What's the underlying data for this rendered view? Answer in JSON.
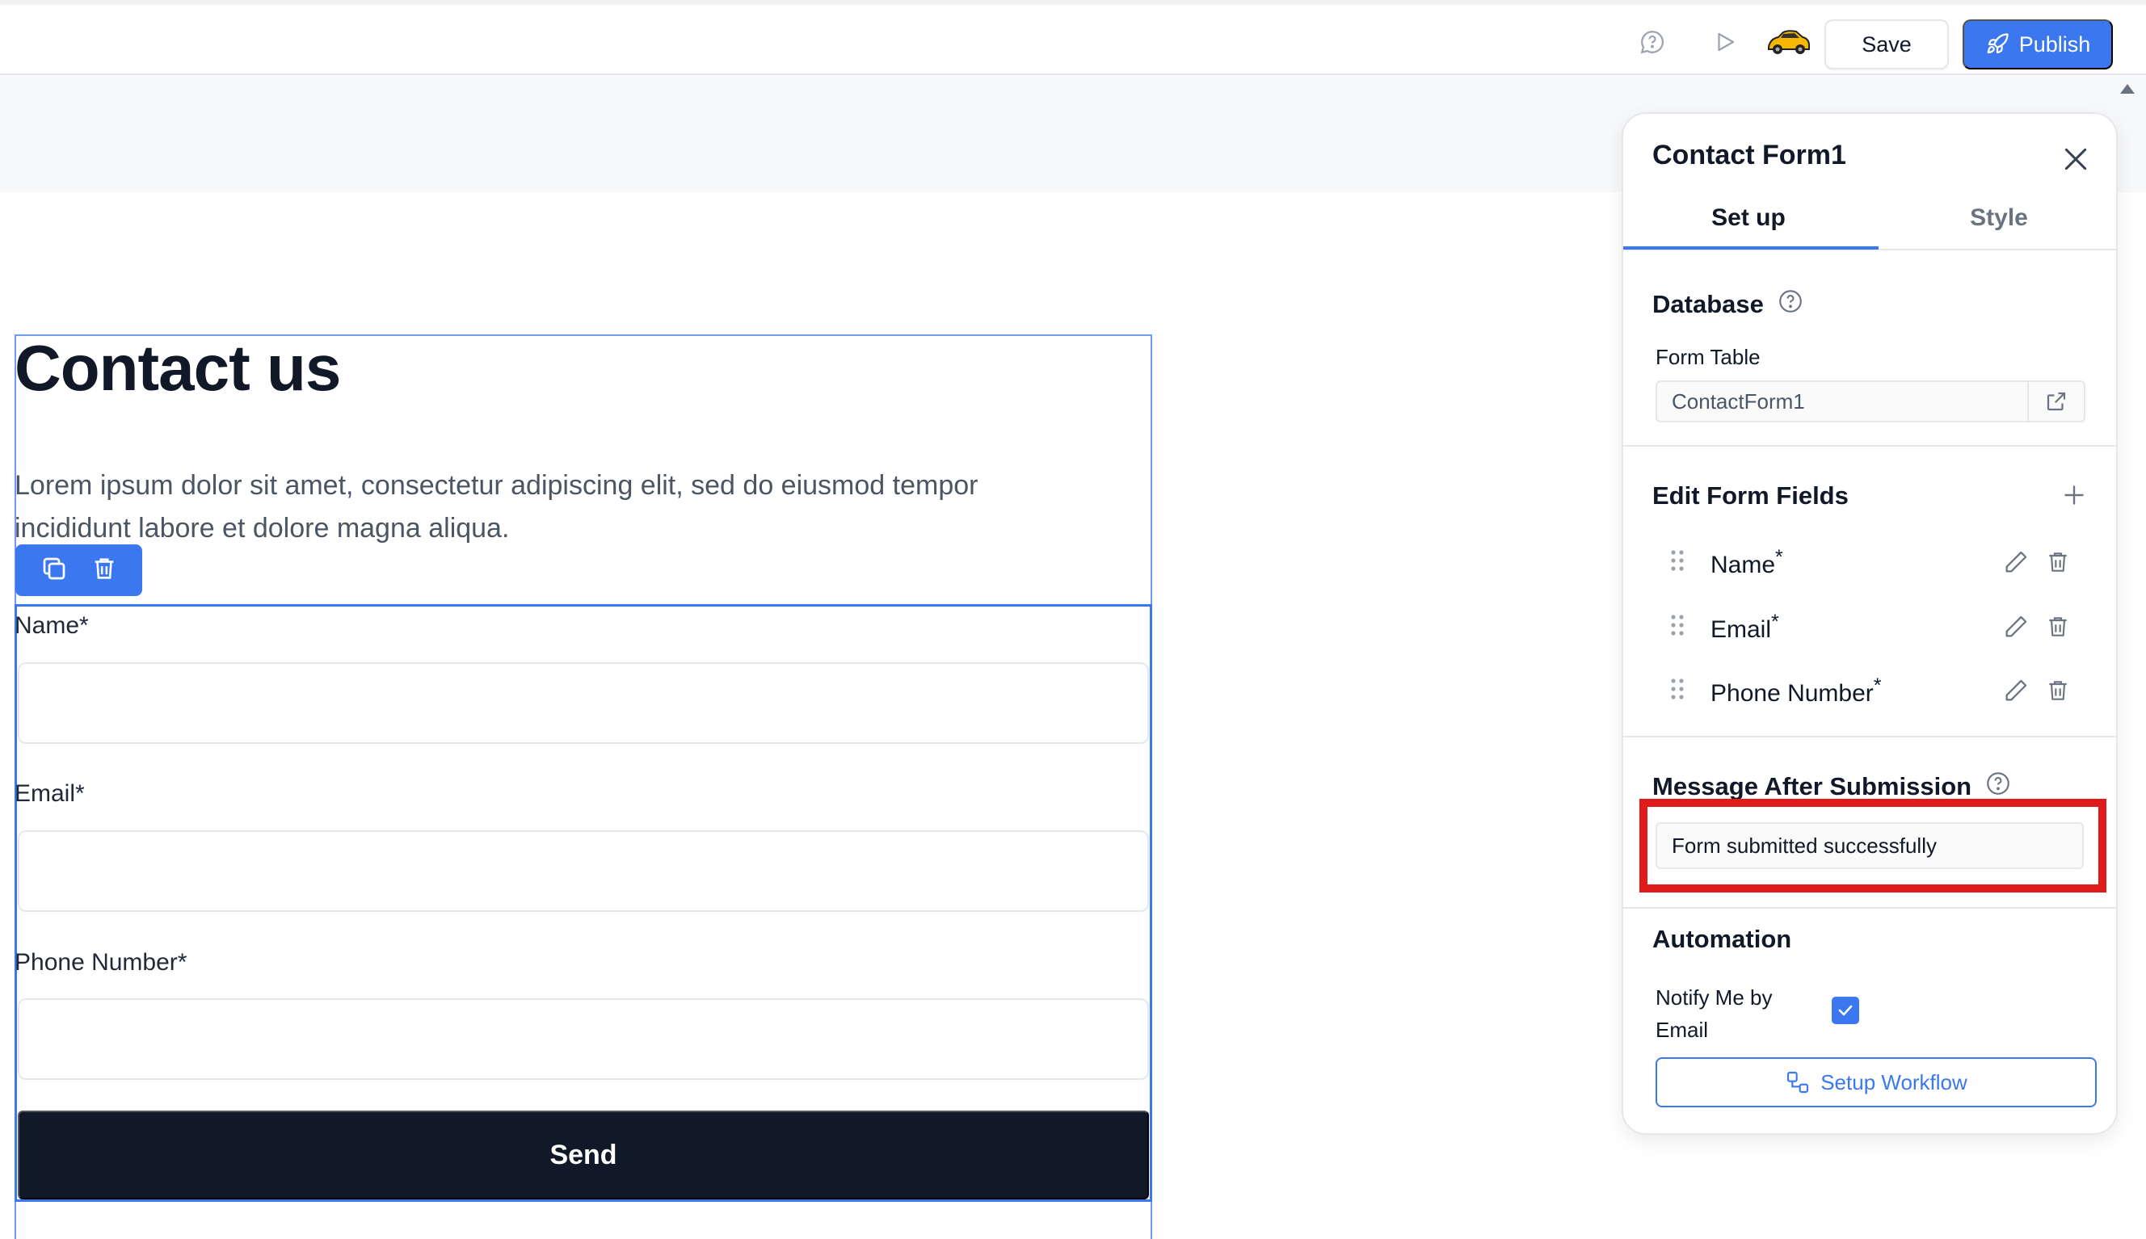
{
  "toolbar": {
    "save_label": "Save",
    "publish_label": "Publish",
    "icons": [
      "help-chat-icon",
      "preview-play-icon",
      "car-avatar-icon"
    ]
  },
  "canvas": {
    "heading": "Contact us",
    "paragraph": "Lorem ipsum dolor sit amet, consectetur adipiscing elit, sed do eiusmod tempor incididunt labore et dolore magna aliqua.",
    "form": {
      "fields": [
        {
          "label": "Name*"
        },
        {
          "label": "Email*"
        },
        {
          "label": "Phone Number*"
        }
      ],
      "submit_label": "Send"
    }
  },
  "panel": {
    "title": "Contact Form1",
    "tabs": [
      {
        "label": "Set up",
        "active": true
      },
      {
        "label": "Style",
        "active": false
      }
    ],
    "database": {
      "title": "Database",
      "form_table_label": "Form Table",
      "form_table_value": "ContactForm1"
    },
    "edit_fields": {
      "title": "Edit Form Fields",
      "fields": [
        {
          "name": "Name",
          "required_mark": "*"
        },
        {
          "name": "Email",
          "required_mark": "*"
        },
        {
          "name": "Phone Number",
          "required_mark": "*"
        }
      ]
    },
    "message": {
      "title": "Message After Submission",
      "value": "Form submitted successfully"
    },
    "automation": {
      "title": "Automation",
      "notify_label": "Notify Me by Email",
      "notify_checked": true,
      "workflow_label": "Setup Workflow"
    }
  },
  "colors": {
    "accent": "#3b78f0",
    "highlight": "#e01b1b",
    "dark_button": "#111827"
  }
}
